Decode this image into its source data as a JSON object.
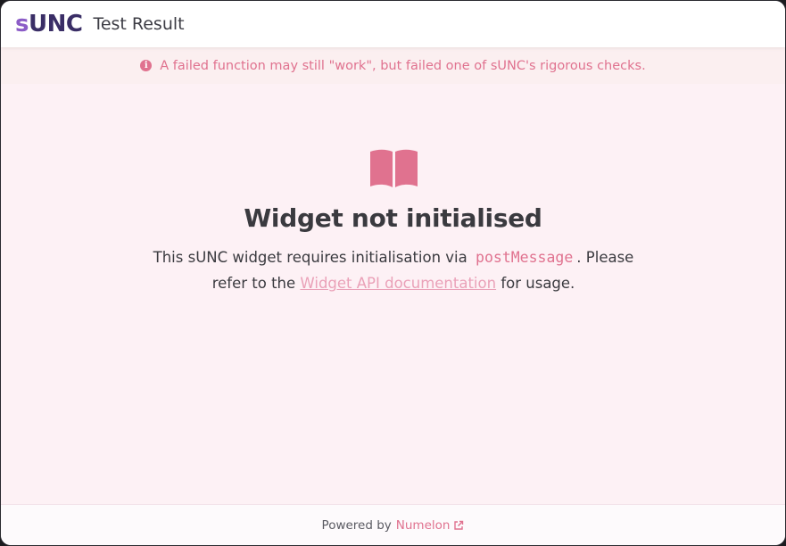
{
  "header": {
    "logo_s": "s",
    "logo_rest": "UNC",
    "title": "Test Result"
  },
  "notice": {
    "icon": "info-icon",
    "text": "A failed function may still \"work\", but failed one of sUNC's rigorous checks."
  },
  "main": {
    "icon": "book-open-icon",
    "heading": "Widget not initialised",
    "desc_part1": "This sUNC widget requires initialisation via",
    "code": "postMessage",
    "desc_part2": ". Please refer to the",
    "link_text": "Widget API documentation",
    "desc_part3": "for usage."
  },
  "footer": {
    "powered_by": "Powered by",
    "link_text": "Numelon",
    "link_icon": "external-link-icon"
  },
  "colors": {
    "accent": "#e0728f",
    "logo_s": "#8b5cc7",
    "logo_rest": "#3a2e66",
    "background": "#fdf1f5"
  }
}
